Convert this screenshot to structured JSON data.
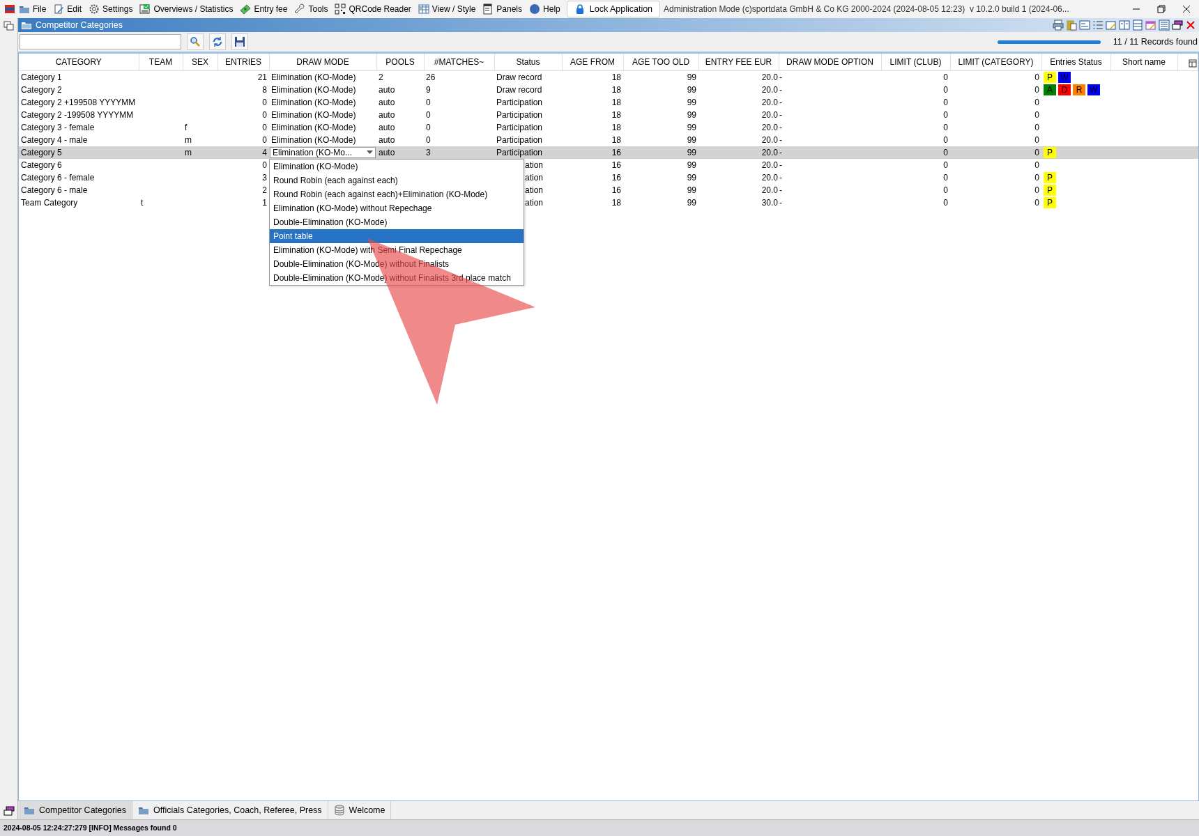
{
  "menu": [
    {
      "label": "File"
    },
    {
      "label": "Edit"
    },
    {
      "label": "Settings"
    },
    {
      "label": "Overviews / Statistics"
    },
    {
      "label": "Entry fee"
    },
    {
      "label": "Tools"
    },
    {
      "label": "QRCode Reader"
    },
    {
      "label": "View / Style"
    },
    {
      "label": "Panels"
    },
    {
      "label": "Help"
    }
  ],
  "lock_button": "Lock Application",
  "window": {
    "title": "Administration Mode (c)sportdata GmbH & Co KG 2000-2024 (2024-08-05 12:23)  v 10.2.0 build 1 (2024-06..."
  },
  "panel": {
    "title": "Competitor Categories",
    "records": "11 / 11 Records found",
    "progress": {
      "level": 1
    }
  },
  "table": {
    "columns": [
      "CATEGORY",
      "TEAM",
      "SEX",
      "ENTRIES",
      "DRAW MODE",
      "POOLS",
      "#MATCHES~",
      "Status",
      "AGE FROM",
      "AGE TOO OLD",
      "ENTRY FEE EUR",
      "DRAW MODE OPTION",
      "LIMIT (CLUB)",
      "LIMIT (CATEGORY)",
      "Entries Status",
      "Short name"
    ],
    "rows": [
      {
        "category": "Category 1",
        "entries": "21",
        "draw_mode": "Elimination (KO-Mode)",
        "pools": "2",
        "matches": "26",
        "status": "Draw record",
        "age_from": "18",
        "age_too_old": "99",
        "entry_fee": "20.0",
        "draw_mode_option": "-",
        "limit_club": "0",
        "limit_category": "0",
        "entries_status": [
          {
            "label": "P",
            "color": "#ffff00"
          },
          {
            "label": "W",
            "color": "#0000ff"
          }
        ],
        "selected": false,
        "editing": false
      },
      {
        "category": "Category 2",
        "entries": "8",
        "draw_mode": "Elimination (KO-Mode)",
        "pools": "auto",
        "matches": "9",
        "status": "Draw record",
        "age_from": "18",
        "age_too_old": "99",
        "entry_fee": "20.0",
        "draw_mode_option": "-",
        "limit_club": "0",
        "limit_category": "0",
        "entries_status": [
          {
            "label": "A",
            "color": "#008000"
          },
          {
            "label": "D",
            "color": "#ff0000"
          },
          {
            "label": "R",
            "color": "#ff8000"
          },
          {
            "label": "W",
            "color": "#0000ff"
          }
        ],
        "selected": false,
        "editing": false
      },
      {
        "category": "Category 2 +199508 YYYYMM",
        "entries": "0",
        "draw_mode": "Elimination (KO-Mode)",
        "pools": "auto",
        "matches": "0",
        "status": "Participation",
        "age_from": "18",
        "age_too_old": "99",
        "entry_fee": "20.0",
        "draw_mode_option": "-",
        "limit_club": "0",
        "limit_category": "0",
        "selected": false,
        "editing": false
      },
      {
        "category": "Category 2 -199508 YYYYMM",
        "entries": "0",
        "draw_mode": "Elimination (KO-Mode)",
        "pools": "auto",
        "matches": "0",
        "status": "Participation",
        "age_from": "18",
        "age_too_old": "99",
        "entry_fee": "20.0",
        "draw_mode_option": "-",
        "limit_club": "0",
        "limit_category": "0",
        "selected": false,
        "editing": false
      },
      {
        "category": "Category 3 - female",
        "sex": "f",
        "entries": "0",
        "draw_mode": "Elimination (KO-Mode)",
        "pools": "auto",
        "matches": "0",
        "status": "Participation",
        "age_from": "18",
        "age_too_old": "99",
        "entry_fee": "20.0",
        "draw_mode_option": "-",
        "limit_club": "0",
        "limit_category": "0",
        "selected": false,
        "editing": false
      },
      {
        "category": "Category 4 - male",
        "sex": "m",
        "entries": "0",
        "draw_mode": "Elimination (KO-Mode)",
        "pools": "auto",
        "matches": "0",
        "status": "Participation",
        "age_from": "18",
        "age_too_old": "99",
        "entry_fee": "20.0",
        "draw_mode_option": "-",
        "limit_club": "0",
        "limit_category": "0",
        "selected": false,
        "editing": false
      },
      {
        "category": "Category 5",
        "sex": "m",
        "entries": "4",
        "draw_mode": "Elimination (KO-Mo...",
        "pools": "auto",
        "matches": "3",
        "status": "Participation",
        "age_from": "16",
        "age_too_old": "99",
        "entry_fee": "20.0",
        "draw_mode_option": "-",
        "limit_club": "0",
        "limit_category": "0",
        "entries_status": [
          {
            "label": "P",
            "color": "#ffff00"
          }
        ],
        "selected": true,
        "editing": true
      },
      {
        "category": "Category 6",
        "entries": "0",
        "status": "ation",
        "age_from": "16",
        "age_too_old": "99",
        "entry_fee": "20.0",
        "draw_mode_option": "-",
        "limit_club": "0",
        "limit_category": "0",
        "selected": false,
        "editing": false
      },
      {
        "category": "Category 6 - female",
        "entries": "3",
        "status": "ation",
        "age_from": "16",
        "age_too_old": "99",
        "entry_fee": "20.0",
        "draw_mode_option": "-",
        "limit_club": "0",
        "limit_category": "0",
        "entries_status": [
          {
            "label": "P",
            "color": "#ffff00"
          }
        ],
        "selected": false,
        "editing": false
      },
      {
        "category": "Category 6 - male",
        "entries": "2",
        "status": "ation",
        "age_from": "16",
        "age_too_old": "99",
        "entry_fee": "20.0",
        "draw_mode_option": "-",
        "limit_club": "0",
        "limit_category": "0",
        "entries_status": [
          {
            "label": "P",
            "color": "#ffff00"
          }
        ],
        "selected": false,
        "editing": false
      },
      {
        "category": "Team Category",
        "team": "t",
        "entries": "1",
        "status": "ation",
        "age_from": "18",
        "age_too_old": "99",
        "entry_fee": "30.0",
        "draw_mode_option": "-",
        "limit_club": "0",
        "limit_category": "0",
        "entries_status": [
          {
            "label": "P",
            "color": "#ffff00"
          }
        ],
        "selected": false,
        "editing": false
      }
    ]
  },
  "draw_mode_dropdown": [
    {
      "label": "Elimination (KO-Mode)",
      "selected": false
    },
    {
      "label": "Round Robin (each against each)",
      "selected": false
    },
    {
      "label": "Round Robin (each against each)+Elimination (KO-Mode)",
      "selected": false
    },
    {
      "label": "Elimination (KO-Mode) without Repechage",
      "selected": false
    },
    {
      "label": "Double-Elimination (KO-Mode)",
      "selected": false
    },
    {
      "label": "Point table",
      "selected": true
    },
    {
      "label": "Elimination (KO-Mode) with Semi Final Repechage",
      "selected": false
    },
    {
      "label": "Double-Elimination (KO-Mode) without Finalists",
      "selected": false
    },
    {
      "label": "Double-Elimination (KO-Mode) without Finalists 3rd place match",
      "selected": false
    }
  ],
  "bottom_tabs": [
    {
      "label": "Competitor Categories",
      "selected": true
    },
    {
      "label": "Officials Categories, Coach, Referee, Press",
      "selected": false
    },
    {
      "label": "Welcome",
      "selected": false
    }
  ],
  "status_bar": "2024-08-05 12:24:27:279 [INFO] Messages found 0"
}
